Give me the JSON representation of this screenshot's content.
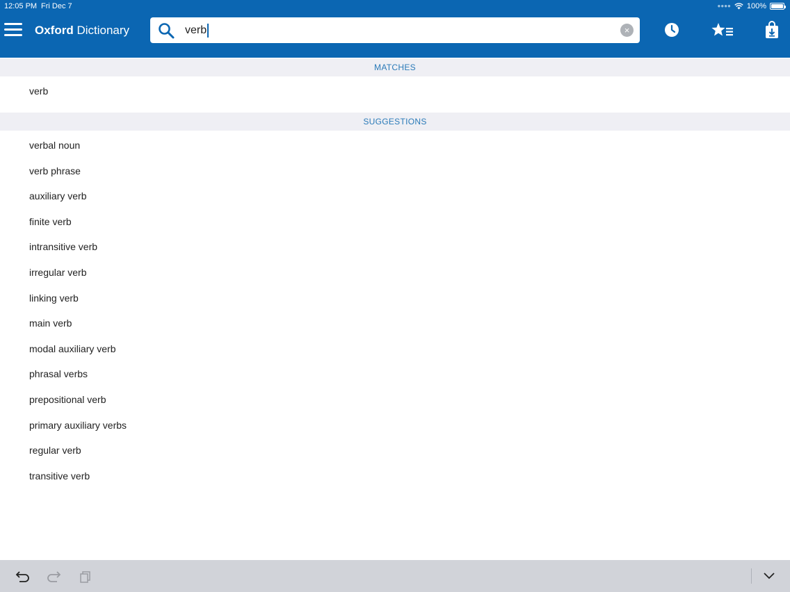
{
  "status_bar": {
    "time": "12:05 PM",
    "date": "Fri Dec 7",
    "battery": "100%"
  },
  "header": {
    "app_name_bold": "Oxford",
    "app_name_rest": " Dictionary",
    "icons": [
      "menu-icon",
      "history-clock-icon",
      "favorites-star-icon",
      "downloads-bag-icon"
    ]
  },
  "search": {
    "value": "verb"
  },
  "matches": {
    "header": "MATCHES",
    "items": [
      "verb"
    ]
  },
  "suggestions": {
    "header": "SUGGESTIONS",
    "items": [
      "verbal noun",
      "verb phrase",
      "auxiliary verb",
      "finite verb",
      "intransitive verb",
      "irregular verb",
      "linking verb",
      "main verb",
      "modal auxiliary verb",
      "phrasal verbs",
      "prepositional verb",
      "primary auxiliary verbs",
      "regular verb",
      "transitive verb"
    ]
  },
  "keyboard_bar": {
    "icons": [
      "undo-icon",
      "redo-icon",
      "paste-icon",
      "hide-keyboard-chevron-icon"
    ]
  },
  "colors": {
    "header_blue": "#0b66b2",
    "section_bg": "#efeff4",
    "section_text": "#2a7ab8"
  }
}
